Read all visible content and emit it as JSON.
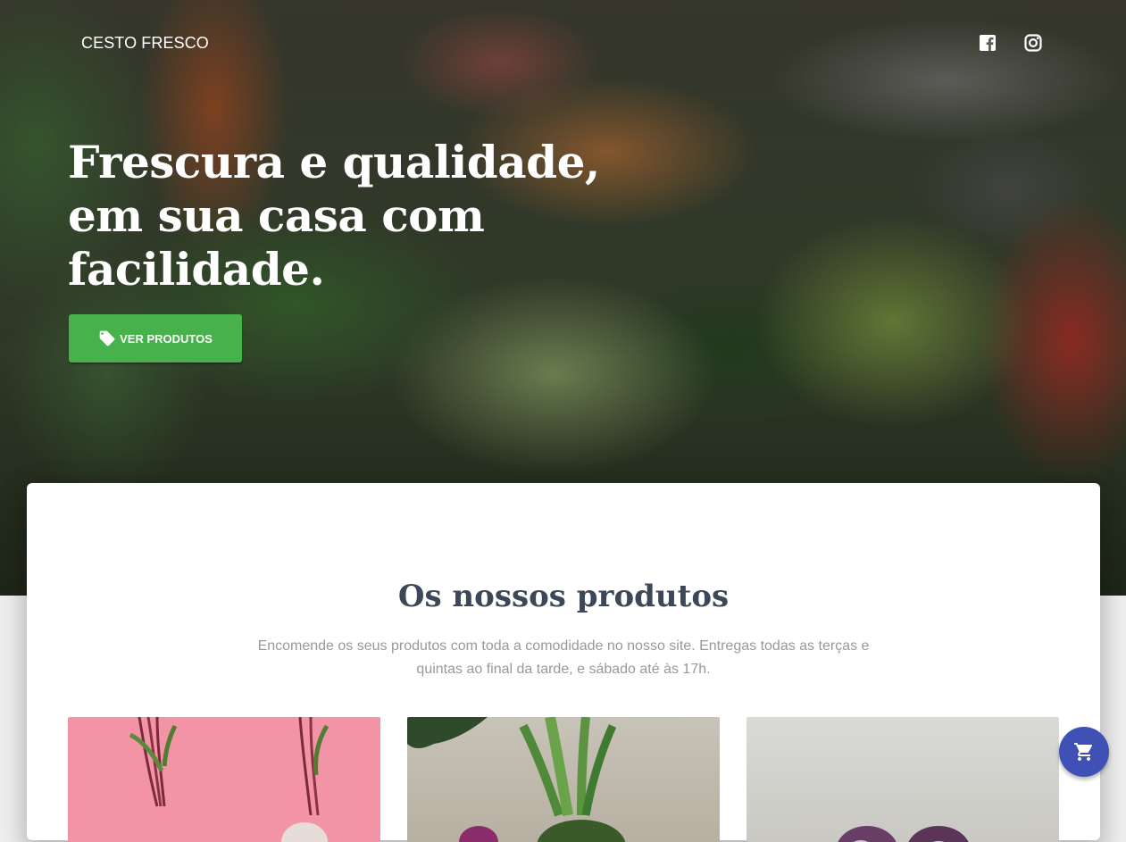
{
  "navbar": {
    "brand": "CESTO FRESCO",
    "social": [
      {
        "name": "facebook",
        "icon": "facebook-icon"
      },
      {
        "name": "instagram",
        "icon": "instagram-icon"
      }
    ]
  },
  "hero": {
    "headline": "Frescura e qualidade,\nem sua casa com\nfacilidade.",
    "cta_label": "VER PRODUTOS",
    "cta_icon": "tag-icon"
  },
  "products_section": {
    "title": "Os nossos produtos",
    "description": "Encomende os seus produtos com toda a comodidade no nosso site. Entregas todas as terças e quintas ao final da tarde, e sábado até às 17h.",
    "products": [
      {
        "image": "beetroot-photo"
      },
      {
        "image": "radish-photo"
      },
      {
        "image": "turnip-photo"
      }
    ]
  },
  "fab": {
    "icon": "cart-icon"
  },
  "colors": {
    "accent_green": "#47b14b",
    "fab_blue": "#3f51b5",
    "title_text": "#3c4858",
    "muted_text": "#999999"
  }
}
